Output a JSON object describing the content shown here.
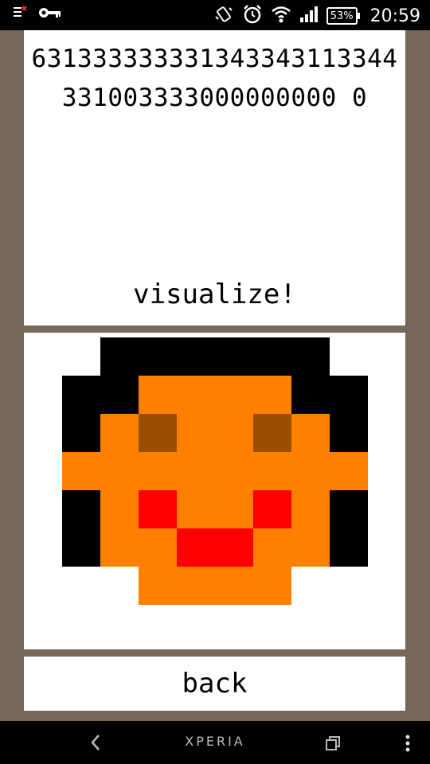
{
  "status_bar": {
    "time": "20:59",
    "battery": "53%",
    "icons": [
      "notification-icon",
      "key-icon",
      "vibrate-icon",
      "alarm-icon",
      "wifi-icon",
      "signal-icon",
      "battery-icon"
    ]
  },
  "code_display": {
    "text": "631333333331343343113344331003333000000000 0"
  },
  "visualize_button": {
    "label": "visualize!"
  },
  "pixel_art": {
    "cols": 8,
    "rows": 7,
    "palette": {
      "0": "#ffffff",
      "1": "#ff8000",
      "3": "#000000",
      "4": "#ff0000",
      "6": "#9a4f00"
    },
    "cells": [
      [
        0,
        3,
        3,
        3,
        3,
        3,
        3,
        0
      ],
      [
        3,
        3,
        1,
        1,
        1,
        1,
        3,
        3
      ],
      [
        3,
        1,
        6,
        1,
        1,
        6,
        1,
        3
      ],
      [
        1,
        1,
        1,
        1,
        1,
        1,
        1,
        1
      ],
      [
        3,
        1,
        4,
        1,
        1,
        4,
        1,
        3
      ],
      [
        3,
        1,
        1,
        4,
        4,
        1,
        1,
        3
      ],
      [
        0,
        0,
        1,
        1,
        1,
        1,
        0,
        0
      ]
    ]
  },
  "back_button": {
    "label": "back"
  },
  "nav_bar": {
    "brand": "XPERIA",
    "icons": [
      "back-icon",
      "recent-apps-icon",
      "menu-icon"
    ]
  }
}
